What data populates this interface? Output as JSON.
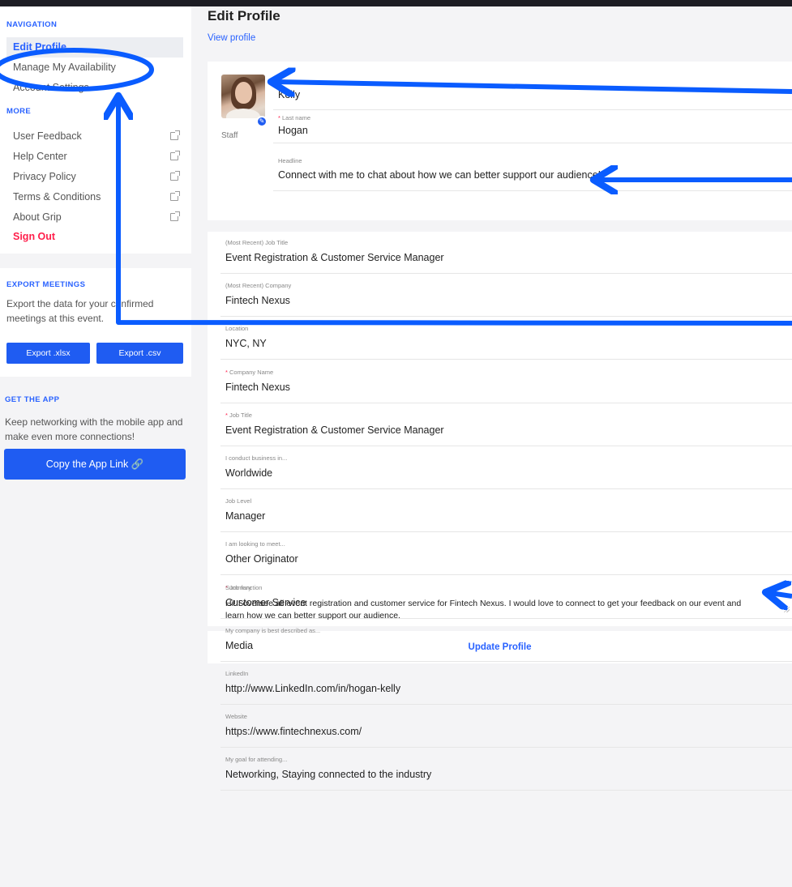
{
  "sidebar": {
    "navigation_title": "NAVIGATION",
    "nav_items": [
      {
        "label": "Edit Profile"
      },
      {
        "label": "Manage My Availability"
      },
      {
        "label": "Account Settings"
      }
    ],
    "more_title": "MORE",
    "more_items": [
      {
        "label": "User Feedback"
      },
      {
        "label": "Help Center"
      },
      {
        "label": "Privacy Policy"
      },
      {
        "label": "Terms & Conditions"
      },
      {
        "label": "About Grip"
      }
    ],
    "sign_out": "Sign Out",
    "export": {
      "title": "EXPORT MEETINGS",
      "text": "Export the data for your confirmed meetings at this event.",
      "xlsx_label": "Export .xlsx",
      "csv_label": "Export .csv"
    },
    "get_app": {
      "title": "GET THE APP",
      "text": "Keep networking with the mobile app and make even more connections!",
      "button_label": "Copy the App Link 🔗"
    }
  },
  "main": {
    "title": "Edit Profile",
    "view_profile": "View profile",
    "profile_role": "Staff",
    "first_name_value": "Kelly",
    "last_name_label": "Last name",
    "last_name_value": "Hogan",
    "headline_label": "Headline",
    "headline_value": "Connect with me to chat about how we can better support our audience!",
    "fields": [
      {
        "label": "(Most Recent) Job Title",
        "value": "Event Registration & Customer Service Manager",
        "required": false
      },
      {
        "label": "(Most Recent) Company",
        "value": "Fintech Nexus",
        "required": false
      },
      {
        "label": "Location",
        "value": "NYC, NY",
        "required": false
      },
      {
        "label": "Company Name",
        "value": "Fintech Nexus",
        "required": true
      },
      {
        "label": "Job Title",
        "value": "Event Registration & Customer Service Manager",
        "required": true
      },
      {
        "label": "I conduct business in...",
        "value": "Worldwide",
        "required": false
      },
      {
        "label": "Job Level",
        "value": "Manager",
        "required": false
      },
      {
        "label": "I am looking to meet...",
        "value": "Other Originator",
        "required": false
      },
      {
        "label": "Job function",
        "value": "Customer Service",
        "required": true
      },
      {
        "label": "My company is best described as...",
        "value": "Media",
        "required": false
      },
      {
        "label": "LinkedIn",
        "value": "http://www.LinkedIn.com/in/hogan-kelly",
        "required": false
      },
      {
        "label": "Website",
        "value": "https://www.fintechnexus.com/",
        "required": false
      },
      {
        "label": "My goal for attending...",
        "value": "Networking, Staying connected to the industry",
        "required": false
      }
    ],
    "summary_label": "Summary",
    "summary_value": "Hi! I oversee all event registration and customer service for Fintech Nexus. I would love to connect to get your feedback on our event and learn how we can better support our audience.",
    "update_button": "Update Profile"
  },
  "colors": {
    "accent": "#2962ff",
    "button": "#1f5cf2",
    "danger": "#ff1f4b",
    "annotation": "#0a5cff",
    "backdrop": "#1d1d24"
  }
}
